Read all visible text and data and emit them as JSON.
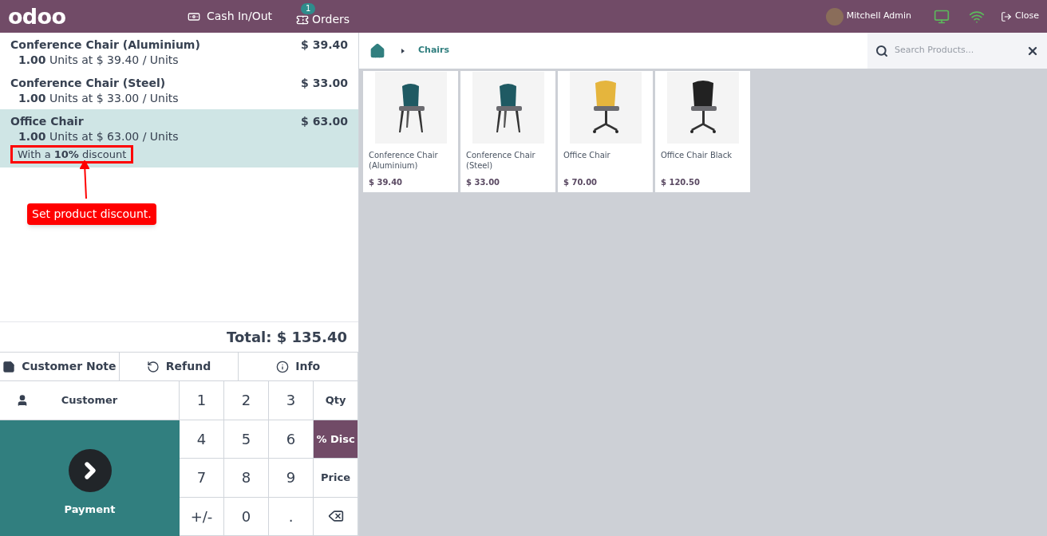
{
  "navbar": {
    "logo": "odoo",
    "cash_button": "Cash In/Out",
    "orders_button": "Orders",
    "orders_badge": "1",
    "user": "Mitchell Admin",
    "close_button": "Close"
  },
  "order_lines": [
    {
      "name": "Conference Chair (Aluminium)",
      "price": "$ 39.40",
      "quantity": "1.00",
      "unit_text": "Units at $ 39.40 / Units",
      "selected": false
    },
    {
      "name": "Conference Chair (Steel)",
      "price": "$ 33.00",
      "quantity": "1.00",
      "unit_text": "Units at $ 33.00 / Units",
      "selected": false
    },
    {
      "name": "Office Chair",
      "price": "$ 63.00",
      "quantity": "1.00",
      "unit_text": "Units at $ 63.00 / Units",
      "discount": "With a **10%** discount",
      "selected": true
    }
  ],
  "annotation": {
    "text": "Set product discount."
  },
  "total": "Total: $ 135.40",
  "control_buttons": [
    {
      "label": "Customer Note",
      "kind": "note"
    },
    {
      "label": "Refund",
      "kind": "refund"
    },
    {
      "label": "Info",
      "kind": "info"
    }
  ],
  "customer_button": "Customer",
  "payment_button": "Payment",
  "numpad": [
    {
      "label": "1",
      "kind": "digit",
      "selected": false
    },
    {
      "label": "2",
      "kind": "digit",
      "selected": false
    },
    {
      "label": "3",
      "kind": "digit",
      "selected": false
    },
    {
      "label": "Qty",
      "kind": "mode",
      "selected": false
    },
    {
      "label": "4",
      "kind": "digit",
      "selected": false
    },
    {
      "label": "5",
      "kind": "digit",
      "selected": false
    },
    {
      "label": "6",
      "kind": "digit",
      "selected": false
    },
    {
      "label": "% Disc",
      "kind": "mode",
      "selected": true
    },
    {
      "label": "7",
      "kind": "digit",
      "selected": false
    },
    {
      "label": "8",
      "kind": "digit",
      "selected": false
    },
    {
      "label": "9",
      "kind": "digit",
      "selected": false
    },
    {
      "label": "Price",
      "kind": "mode",
      "selected": false
    },
    {
      "label": "+/-",
      "kind": "digit",
      "selected": false
    },
    {
      "label": "0",
      "kind": "digit",
      "selected": false
    },
    {
      "label": ".",
      "kind": "digit",
      "selected": false
    },
    {
      "kind": "backspace",
      "selected": false
    }
  ],
  "breadcrumb": {
    "category": "Chairs"
  },
  "search": {
    "placeholder": "Search Products..."
  },
  "products": [
    {
      "name": "Conference Chair (Aluminium)",
      "price": "$ 39.40"
    },
    {
      "name": "Conference Chair (Steel)",
      "price": "$ 33.00"
    },
    {
      "name": "Office Chair",
      "price": "$ 70.00"
    },
    {
      "name": "Office Chair Black",
      "price": "$ 120.50"
    }
  ]
}
